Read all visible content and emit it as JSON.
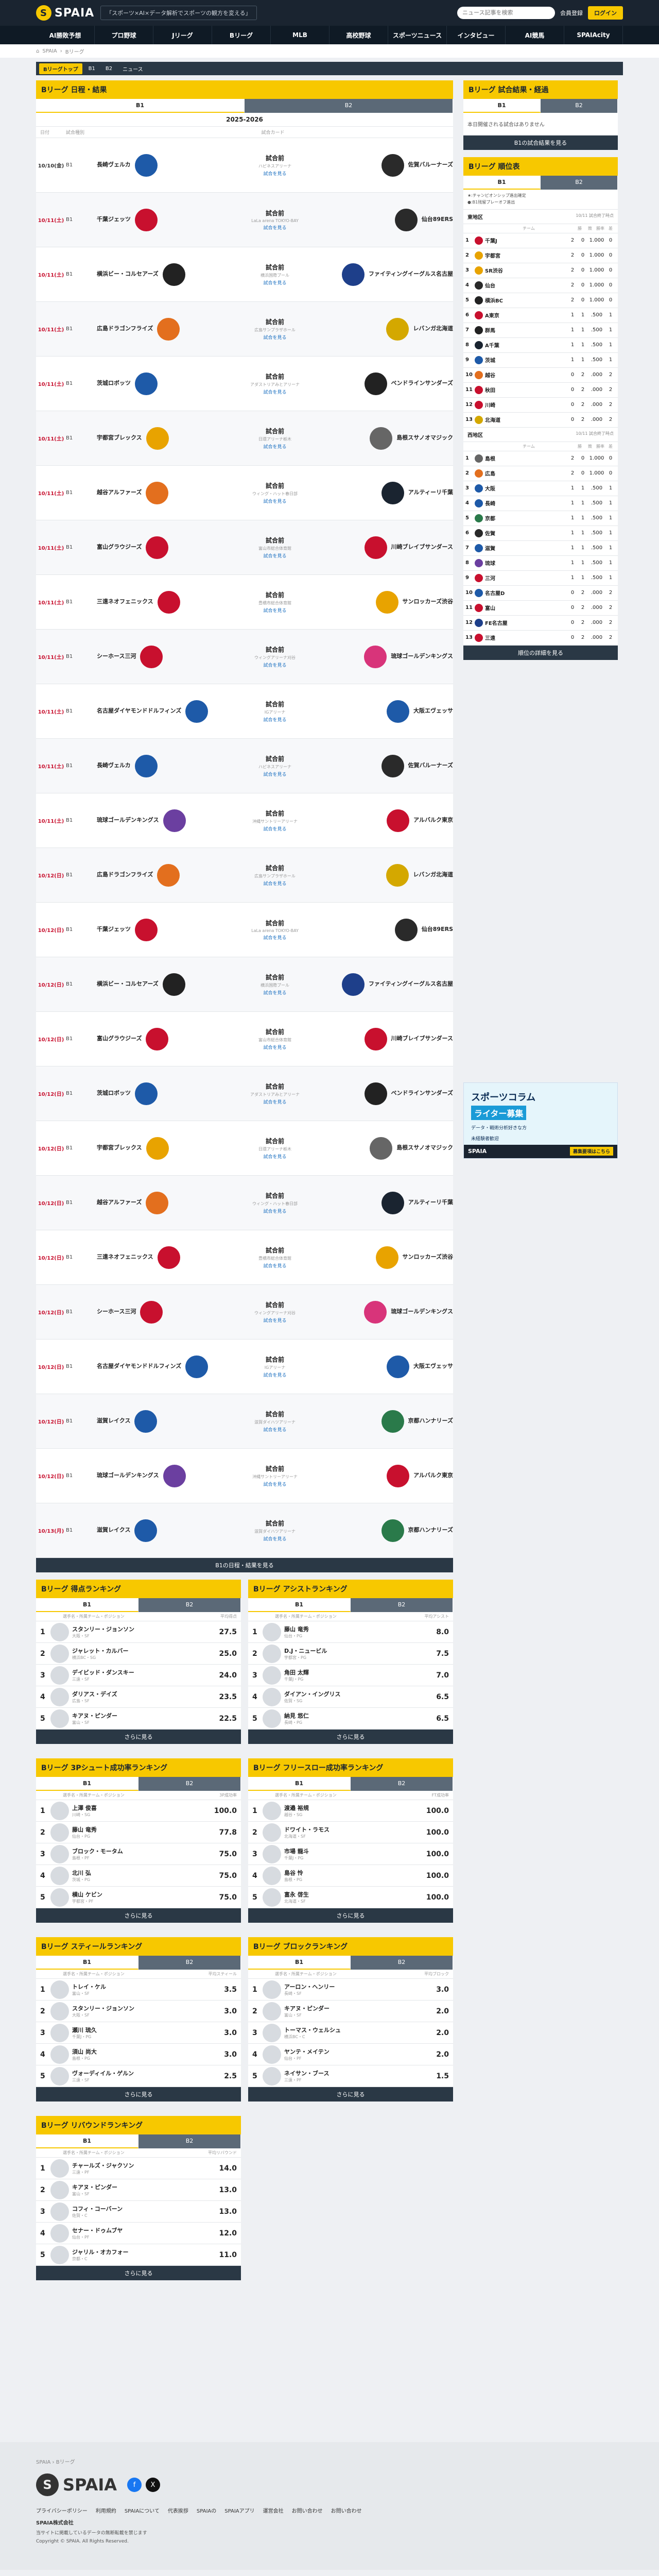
{
  "header": {
    "brand": "SPAIA",
    "tagline": "「スポーツ×AI×データ解析でスポーツの観方を変える」",
    "search_placeholder": "ニュース記事を検索",
    "member": "会員登録",
    "login": "ログイン"
  },
  "nav": [
    "AI勝敗予想",
    "プロ野球",
    "Jリーグ",
    "Bリーグ",
    "MLB",
    "高校野球",
    "スポーツニュース",
    "インタビュー",
    "AI競馬",
    "SPAIAcity"
  ],
  "breadcrumb": [
    "SPAIA",
    "Bリーグ"
  ],
  "subnav": [
    "Bリーグトップ",
    "B1",
    "B2",
    "ニュース"
  ],
  "schedule": {
    "title": "Bリーグ 日程・結果",
    "tabs": [
      "B1",
      "B2"
    ],
    "season": "2025-2026",
    "head": [
      "日付",
      "試合種別",
      "試合カード"
    ],
    "more": "B1の日程・結果を見る",
    "games": [
      {
        "date": "10/10(金)",
        "type": "B1",
        "away": "長崎ヴェルカ",
        "home": "佐賀バルーナーズ",
        "time": "試合前",
        "venue": "ハピネスアリーナ",
        "a": "#1e5aa8",
        "h": "#2a2a2a",
        "red": false
      },
      {
        "date": "10/11(土)",
        "type": "B1",
        "away": "千葉ジェッツ",
        "home": "仙台89ERS",
        "time": "試合前",
        "venue": "LaLa arena TOKYO-BAY",
        "a": "#c8102e",
        "h": "#2a2a2a",
        "red": true
      },
      {
        "date": "10/11(土)",
        "type": "B1",
        "away": "横浜ビー・コルセアーズ",
        "home": "ファイティングイーグルス名古屋",
        "time": "試合前",
        "venue": "横浜国際プール",
        "a": "#222",
        "h": "#1e3f8a",
        "red": true
      },
      {
        "date": "10/11(土)",
        "type": "B1",
        "away": "広島ドラゴンフライズ",
        "home": "レバンガ北海道",
        "time": "試合前",
        "venue": "広島サンプラザホール",
        "a": "#e36f1e",
        "h": "#d4a800",
        "red": true
      },
      {
        "date": "10/11(土)",
        "type": "B1",
        "away": "茨城ロボッツ",
        "home": "ベンドラインサンダーズ",
        "time": "試合前",
        "venue": "アダストリアみとアリーナ",
        "a": "#1e5aa8",
        "h": "#222",
        "red": true
      },
      {
        "date": "10/11(土)",
        "type": "B1",
        "away": "宇都宮ブレックス",
        "home": "島根スサノオマジック",
        "time": "試合前",
        "venue": "日環アリーナ栃木",
        "a": "#e8a300",
        "h": "#666",
        "red": true
      },
      {
        "date": "10/11(土)",
        "type": "B1",
        "away": "越谷アルファーズ",
        "home": "アルティーリ千葉",
        "time": "試合前",
        "venue": "ウィング・ハット春日部",
        "a": "#e36f1e",
        "h": "#1a2430",
        "red": true
      },
      {
        "date": "10/11(土)",
        "type": "B1",
        "away": "富山グラウジーズ",
        "home": "川崎ブレイブサンダース",
        "time": "試合前",
        "venue": "富山市総合体育館",
        "a": "#c8102e",
        "h": "#c8102e",
        "red": true
      },
      {
        "date": "10/11(土)",
        "type": "B1",
        "away": "三遠ネオフェニックス",
        "home": "サンロッカーズ渋谷",
        "time": "試合前",
        "venue": "豊橋市総合体育館",
        "a": "#c8102e",
        "h": "#e8a300",
        "red": true
      },
      {
        "date": "10/11(土)",
        "type": "B1",
        "away": "シーホース三河",
        "home": "琉球ゴールデンキングス",
        "time": "試合前",
        "venue": "ウィングアリーナ刈谷",
        "a": "#c8102e",
        "h": "#d8347a",
        "red": true
      },
      {
        "date": "10/11(土)",
        "type": "B1",
        "away": "名古屋ダイヤモンドドルフィンズ",
        "home": "大阪エヴェッサ",
        "time": "試合前",
        "venue": "IGアリーナ",
        "a": "#1e5aa8",
        "h": "#1e5aa8",
        "red": true
      },
      {
        "date": "10/11(土)",
        "type": "B1",
        "away": "長崎ヴェルカ",
        "home": "佐賀バルーナーズ",
        "time": "試合前",
        "venue": "ハピネスアリーナ",
        "a": "#1e5aa8",
        "h": "#2a2a2a",
        "red": true
      },
      {
        "date": "10/11(土)",
        "type": "B1",
        "away": "琉球ゴールデンキングス",
        "home": "アルバルク東京",
        "time": "試合前",
        "venue": "沖縄サントリーアリーナ",
        "a": "#6b3fa0",
        "h": "#c8102e",
        "red": true
      },
      {
        "date": "10/12(日)",
        "type": "B1",
        "away": "広島ドラゴンフライズ",
        "home": "レバンガ北海道",
        "time": "試合前",
        "venue": "広島サンプラザホール",
        "a": "#e36f1e",
        "h": "#d4a800",
        "red": true
      },
      {
        "date": "10/12(日)",
        "type": "B1",
        "away": "千葉ジェッツ",
        "home": "仙台89ERS",
        "time": "試合前",
        "venue": "LaLa arena TOKYO-BAY",
        "a": "#c8102e",
        "h": "#2a2a2a",
        "red": true
      },
      {
        "date": "10/12(日)",
        "type": "B1",
        "away": "横浜ビー・コルセアーズ",
        "home": "ファイティングイーグルス名古屋",
        "time": "試合前",
        "venue": "横浜国際プール",
        "a": "#222",
        "h": "#1e3f8a",
        "red": true
      },
      {
        "date": "10/12(日)",
        "type": "B1",
        "away": "富山グラウジーズ",
        "home": "川崎ブレイブサンダース",
        "time": "試合前",
        "venue": "富山市総合体育館",
        "a": "#c8102e",
        "h": "#c8102e",
        "red": true
      },
      {
        "date": "10/12(日)",
        "type": "B1",
        "away": "茨城ロボッツ",
        "home": "ベンドラインサンダーズ",
        "time": "試合前",
        "venue": "アダストリアみとアリーナ",
        "a": "#1e5aa8",
        "h": "#222",
        "red": true
      },
      {
        "date": "10/12(日)",
        "type": "B1",
        "away": "宇都宮ブレックス",
        "home": "島根スサノオマジック",
        "time": "試合前",
        "venue": "日環アリーナ栃木",
        "a": "#e8a300",
        "h": "#666",
        "red": true
      },
      {
        "date": "10/12(日)",
        "type": "B1",
        "away": "越谷アルファーズ",
        "home": "アルティーリ千葉",
        "time": "試合前",
        "venue": "ウィング・ハット春日部",
        "a": "#e36f1e",
        "h": "#1a2430",
        "red": true
      },
      {
        "date": "10/12(日)",
        "type": "B1",
        "away": "三遠ネオフェニックス",
        "home": "サンロッカーズ渋谷",
        "time": "試合前",
        "venue": "豊橋市総合体育館",
        "a": "#c8102e",
        "h": "#e8a300",
        "red": true
      },
      {
        "date": "10/12(日)",
        "type": "B1",
        "away": "シーホース三河",
        "home": "琉球ゴールデンキングス",
        "time": "試合前",
        "venue": "ウィングアリーナ刈谷",
        "a": "#c8102e",
        "h": "#d8347a",
        "red": true
      },
      {
        "date": "10/12(日)",
        "type": "B1",
        "away": "名古屋ダイヤモンドドルフィンズ",
        "home": "大阪エヴェッサ",
        "time": "試合前",
        "venue": "IGアリーナ",
        "a": "#1e5aa8",
        "h": "#1e5aa8",
        "red": true
      },
      {
        "date": "10/12(日)",
        "type": "B1",
        "away": "滋賀レイクス",
        "home": "京都ハンナリーズ",
        "time": "試合前",
        "venue": "滋賀ダイハツアリーナ",
        "a": "#1e5aa8",
        "h": "#2a7a4a",
        "red": true
      },
      {
        "date": "10/12(日)",
        "type": "B1",
        "away": "琉球ゴールデンキングス",
        "home": "アルバルク東京",
        "time": "試合前",
        "venue": "沖縄サントリーアリーナ",
        "a": "#6b3fa0",
        "h": "#c8102e",
        "red": true
      },
      {
        "date": "10/13(月)",
        "type": "B1",
        "away": "滋賀レイクス",
        "home": "京都ハンナリーズ",
        "time": "試合前",
        "venue": "滋賀ダイハツアリーナ",
        "a": "#1e5aa8",
        "h": "#2a7a4a",
        "red": true
      }
    ]
  },
  "rankings": [
    {
      "title": "Bリーグ 得点ランキング",
      "head": [
        "選手名・所属チーム・ポジション",
        "平均得点"
      ],
      "rows": [
        [
          "1",
          "スタンリー・ジョンソン",
          "大阪・SF",
          "27.5"
        ],
        [
          "2",
          "ジャレット・カルバー",
          "横浜BC・SG",
          "25.0"
        ],
        [
          "3",
          "デイビッド・ダンスキー",
          "三遠・SF",
          "24.0"
        ],
        [
          "4",
          "ダリアス・デイズ",
          "広島・SF",
          "23.5"
        ],
        [
          "5",
          "キアヌ・ピンダー",
          "富山・SF",
          "22.5"
        ]
      ]
    },
    {
      "title": "Bリーグ アシストランキング",
      "head": [
        "選手名・所属チーム・ポジション",
        "平均アシスト"
      ],
      "rows": [
        [
          "1",
          "藤山 竜秀",
          "仙台・PG",
          "8.0"
        ],
        [
          "2",
          "D.J・ニュービル",
          "宇都宮・PG",
          "7.5"
        ],
        [
          "3",
          "角田 太輝",
          "千葉J・PG",
          "7.0"
        ],
        [
          "4",
          "ダイアン・イングリス",
          "佐賀・SG",
          "6.5"
        ],
        [
          "5",
          "納見 悠仁",
          "長崎・PG",
          "6.5"
        ]
      ]
    },
    {
      "title": "Bリーグ 3Pシュート成功率ランキング",
      "head": [
        "選手名・所属チーム・ポジション",
        "3P成功率"
      ],
      "rows": [
        [
          "1",
          "上澤 俊喜",
          "川崎・SG",
          "100.0"
        ],
        [
          "2",
          "藤山 竜秀",
          "仙台・PG",
          "77.8"
        ],
        [
          "3",
          "ブロック・モータム",
          "島根・PF",
          "75.0"
        ],
        [
          "4",
          "北川 弘",
          "茨城・PG",
          "75.0"
        ],
        [
          "5",
          "横山 ケビン",
          "宇都宮・PF",
          "75.0"
        ]
      ]
    },
    {
      "title": "Bリーグ フリースロー成功率ランキング",
      "head": [
        "選手名・所属チーム・ポジション",
        "FT成功率"
      ],
      "rows": [
        [
          "1",
          "渡邉 裕規",
          "越谷・SG",
          "100.0"
        ],
        [
          "2",
          "ドワイト・ラモス",
          "北海道・SF",
          "100.0"
        ],
        [
          "3",
          "市場 龍斗",
          "千葉J・PG",
          "100.0"
        ],
        [
          "4",
          "島谷 怜",
          "島根・PG",
          "100.0"
        ],
        [
          "5",
          "富永 啓生",
          "北海道・SF",
          "100.0"
        ]
      ]
    },
    {
      "title": "Bリーグ スティールランキング",
      "head": [
        "選手名・所属チーム・ポジション",
        "平均スティール"
      ],
      "rows": [
        [
          "1",
          "トレイ・ケル",
          "富山・SF",
          "3.5"
        ],
        [
          "2",
          "スタンリー・ジョンソン",
          "大阪・SF",
          "3.0"
        ],
        [
          "3",
          "瀬川 琉久",
          "千葉J・PG",
          "3.0"
        ],
        [
          "4",
          "須山 尚大",
          "島根・PG",
          "3.0"
        ],
        [
          "5",
          "ヴォーディイル・ゲルン",
          "三遠・SF",
          "2.5"
        ]
      ]
    },
    {
      "title": "Bリーグ ブロックランキング",
      "head": [
        "選手名・所属チーム・ポジション",
        "平均ブロック"
      ],
      "rows": [
        [
          "1",
          "アーロン・ヘンリー",
          "長崎・SF",
          "3.0"
        ],
        [
          "2",
          "キアヌ・ピンダー",
          "富山・SF",
          "2.0"
        ],
        [
          "3",
          "トーマス・ウェルシュ",
          "横浜BC・C",
          "2.0"
        ],
        [
          "4",
          "ヤンテ・メイテン",
          "仙台・PF",
          "2.0"
        ],
        [
          "5",
          "ネイサン・ブース",
          "三遠・PF",
          "1.5"
        ]
      ]
    },
    {
      "title": "Bリーグ リバウンドランキング",
      "head": [
        "選手名・所属チーム・ポジション",
        "平均リバウンド"
      ],
      "rows": [
        [
          "1",
          "チャールズ・ジャクソン",
          "三遠・PF",
          "14.0"
        ],
        [
          "2",
          "キアヌ・ピンダー",
          "富山・SF",
          "13.0"
        ],
        [
          "3",
          "コフィ・コーバーン",
          "佐賀・C",
          "13.0"
        ],
        [
          "4",
          "セナー・ドゥムブヤ",
          "仙台・PF",
          "12.0"
        ],
        [
          "5",
          "ジャリル・オカフォー",
          "京都・C",
          "11.0"
        ]
      ]
    }
  ],
  "ranking_tabs": [
    "B1",
    "B2"
  ],
  "ranking_more": "さらに見る",
  "side_results": {
    "title": "Bリーグ 試合結果・経過",
    "tabs": [
      "B1",
      "B2"
    ],
    "empty": "本日開催される試合はありません",
    "more": "B1の試合結果を見る"
  },
  "standings": {
    "title": "Bリーグ 順位表",
    "tabs": [
      "B1",
      "B2"
    ],
    "legend": [
      "★:チャンピオンシップ進出確定",
      "●:B1残留プレーオフ進出"
    ],
    "head": [
      "チーム",
      "勝",
      "敗",
      "勝率",
      "差"
    ],
    "more": "順位の詳細を見る",
    "east_title": "東地区",
    "east_note": "10/11 試合終了時点",
    "west_title": "西地区",
    "west_note": "10/11 試合終了時点",
    "east": [
      [
        "1",
        "千葉J",
        "2",
        "0",
        "1.000",
        "0",
        "#c8102e"
      ],
      [
        "2",
        "宇都宮",
        "2",
        "0",
        "1.000",
        "0",
        "#e8a300"
      ],
      [
        "3",
        "SR渋谷",
        "2",
        "0",
        "1.000",
        "0",
        "#e8a300"
      ],
      [
        "4",
        "仙台",
        "2",
        "0",
        "1.000",
        "0",
        "#2a2a2a"
      ],
      [
        "5",
        "横浜BC",
        "2",
        "0",
        "1.000",
        "0",
        "#222"
      ],
      [
        "6",
        "A東京",
        "1",
        "1",
        ".500",
        "1",
        "#c8102e"
      ],
      [
        "7",
        "群馬",
        "1",
        "1",
        ".500",
        "1",
        "#222"
      ],
      [
        "8",
        "A千葉",
        "1",
        "1",
        ".500",
        "1",
        "#1a2430"
      ],
      [
        "9",
        "茨城",
        "1",
        "1",
        ".500",
        "1",
        "#1e5aa8"
      ],
      [
        "10",
        "越谷",
        "0",
        "2",
        ".000",
        "2",
        "#e36f1e"
      ],
      [
        "11",
        "秋田",
        "0",
        "2",
        ".000",
        "2",
        "#c8102e"
      ],
      [
        "12",
        "川崎",
        "0",
        "2",
        ".000",
        "2",
        "#c8102e"
      ],
      [
        "13",
        "北海道",
        "0",
        "2",
        ".000",
        "2",
        "#d4a800"
      ]
    ],
    "west": [
      [
        "1",
        "島根",
        "2",
        "0",
        "1.000",
        "0",
        "#666"
      ],
      [
        "2",
        "広島",
        "2",
        "0",
        "1.000",
        "0",
        "#e36f1e"
      ],
      [
        "3",
        "大阪",
        "1",
        "1",
        ".500",
        "1",
        "#1e5aa8"
      ],
      [
        "4",
        "長崎",
        "1",
        "1",
        ".500",
        "1",
        "#1e5aa8"
      ],
      [
        "5",
        "京都",
        "1",
        "1",
        ".500",
        "1",
        "#2a7a4a"
      ],
      [
        "6",
        "佐賀",
        "1",
        "1",
        ".500",
        "1",
        "#2a2a2a"
      ],
      [
        "7",
        "滋賀",
        "1",
        "1",
        ".500",
        "1",
        "#1e5aa8"
      ],
      [
        "8",
        "琉球",
        "1",
        "1",
        ".500",
        "1",
        "#6b3fa0"
      ],
      [
        "9",
        "三河",
        "1",
        "1",
        ".500",
        "1",
        "#c8102e"
      ],
      [
        "10",
        "名古屋D",
        "0",
        "2",
        ".000",
        "2",
        "#1e5aa8"
      ],
      [
        "11",
        "富山",
        "0",
        "2",
        ".000",
        "2",
        "#c8102e"
      ],
      [
        "12",
        "FE名古屋",
        "0",
        "2",
        ".000",
        "2",
        "#1e3f8a"
      ],
      [
        "13",
        "三遠",
        "0",
        "2",
        ".000",
        "2",
        "#c8102e"
      ]
    ]
  },
  "ad": {
    "l1": "スポーツコラム",
    "l2": "ライター募集",
    "l3": "データ・戦術分析好きな方",
    "l4": "未経験者歓迎",
    "brand": "SPAIA",
    "btn": "募集要項はこちら"
  },
  "footer": {
    "crumb": [
      "SPAIA",
      "Bリーグ"
    ],
    "brand": "SPAIA",
    "links": [
      "プライバシーポリシー",
      "利用規約",
      "SPAIAについて",
      "代表挨拶",
      "SPAIAの",
      "SPAIAアプリ",
      "運営会社",
      "お問い合わせ",
      "お問い合わせ"
    ],
    "market_title": "SPAIA株式会社",
    "lines": [
      "当サイトに掲載しているデータの無断転載を禁じます",
      "Copyright © SPAIA. All Rights Reserved."
    ]
  }
}
